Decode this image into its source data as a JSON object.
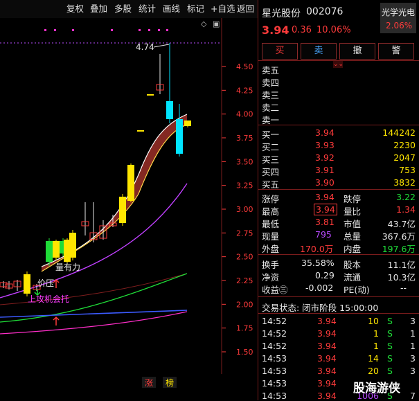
{
  "toolbar": {
    "buttons": [
      "复权",
      "叠加",
      "多股",
      "统计",
      "画线",
      "标记",
      "+自选",
      "返回"
    ]
  },
  "stock": {
    "name": "星光股份",
    "code": "002076",
    "sector": "光学光电",
    "sector_change": "2.06%",
    "price": "3.94",
    "change": "0.36",
    "change_pct": "10.06%"
  },
  "actions": [
    "买",
    "卖",
    "撤",
    "警"
  ],
  "sell_labels": [
    "卖五",
    "卖四",
    "卖三",
    "卖二",
    "卖一"
  ],
  "buy_book": [
    {
      "label": "买一",
      "price": "3.94",
      "vol": "144242"
    },
    {
      "label": "买二",
      "price": "3.93",
      "vol": "2230"
    },
    {
      "label": "买三",
      "price": "3.92",
      "vol": "2047"
    },
    {
      "label": "买四",
      "price": "3.91",
      "vol": "753"
    },
    {
      "label": "买五",
      "price": "3.90",
      "vol": "3832"
    }
  ],
  "stats": {
    "limit_up_label": "涨停",
    "limit_up": "3.94",
    "limit_down_label": "跌停",
    "limit_down": "3.22",
    "high_label": "最高",
    "high": "3.94",
    "vol_ratio_label": "量比",
    "vol_ratio": "1.34",
    "low_label": "最低",
    "low": "3.81",
    "mkt_cap_label": "市值",
    "mkt_cap": "43.7亿",
    "cur_vol_label": "现量",
    "cur_vol": "795",
    "total_vol_label": "总量",
    "total_vol": "367.6万",
    "outer_label": "外盘",
    "outer": "170.0万",
    "inner_label": "内盘",
    "inner": "197.6万",
    "turnover_label": "换手",
    "turnover": "35.58%",
    "shares_label": "股本",
    "shares": "11.1亿",
    "nav_label": "净资",
    "nav": "0.29",
    "float_label": "流通",
    "float": "10.3亿",
    "eps_label": "收益㊂",
    "eps": "-0.002",
    "pe_label": "PE(动)",
    "pe": "--"
  },
  "trade_status": "交易状态: 闭市阶段 15:00:00",
  "ticks": [
    {
      "time": "14:52",
      "price": "3.94",
      "vol": "10",
      "side": "S",
      "num": "3"
    },
    {
      "time": "14:52",
      "price": "3.94",
      "vol": "1",
      "side": "S",
      "num": "1"
    },
    {
      "time": "14:52",
      "price": "3.94",
      "vol": "1",
      "side": "S",
      "num": "1"
    },
    {
      "time": "14:53",
      "price": "3.94",
      "vol": "14",
      "side": "S",
      "num": "3"
    },
    {
      "time": "14:53",
      "price": "3.94",
      "vol": "20",
      "side": "S",
      "num": "3"
    },
    {
      "time": "14:53",
      "price": "3.94",
      "vol": "",
      "side": "",
      "num": ""
    },
    {
      "time": "14:53",
      "price": "3.94",
      "vol": "1006",
      "side": "S",
      "num": "7"
    }
  ],
  "watermark": "股海游侠",
  "chart_data": {
    "type": "candlestick",
    "y_ticks": [
      "4.50",
      "4.25",
      "4.00",
      "3.75",
      "3.50",
      "3.25",
      "3.00",
      "2.75",
      "2.50",
      "2.25",
      "2.00",
      "1.75",
      "1.50"
    ],
    "ylim": [
      1.5,
      4.5
    ],
    "max_label": "4.74",
    "annotations": [
      "量有力",
      "价压",
      "上攻机会托"
    ],
    "bottom_tags": [
      "涨",
      "榜"
    ]
  }
}
